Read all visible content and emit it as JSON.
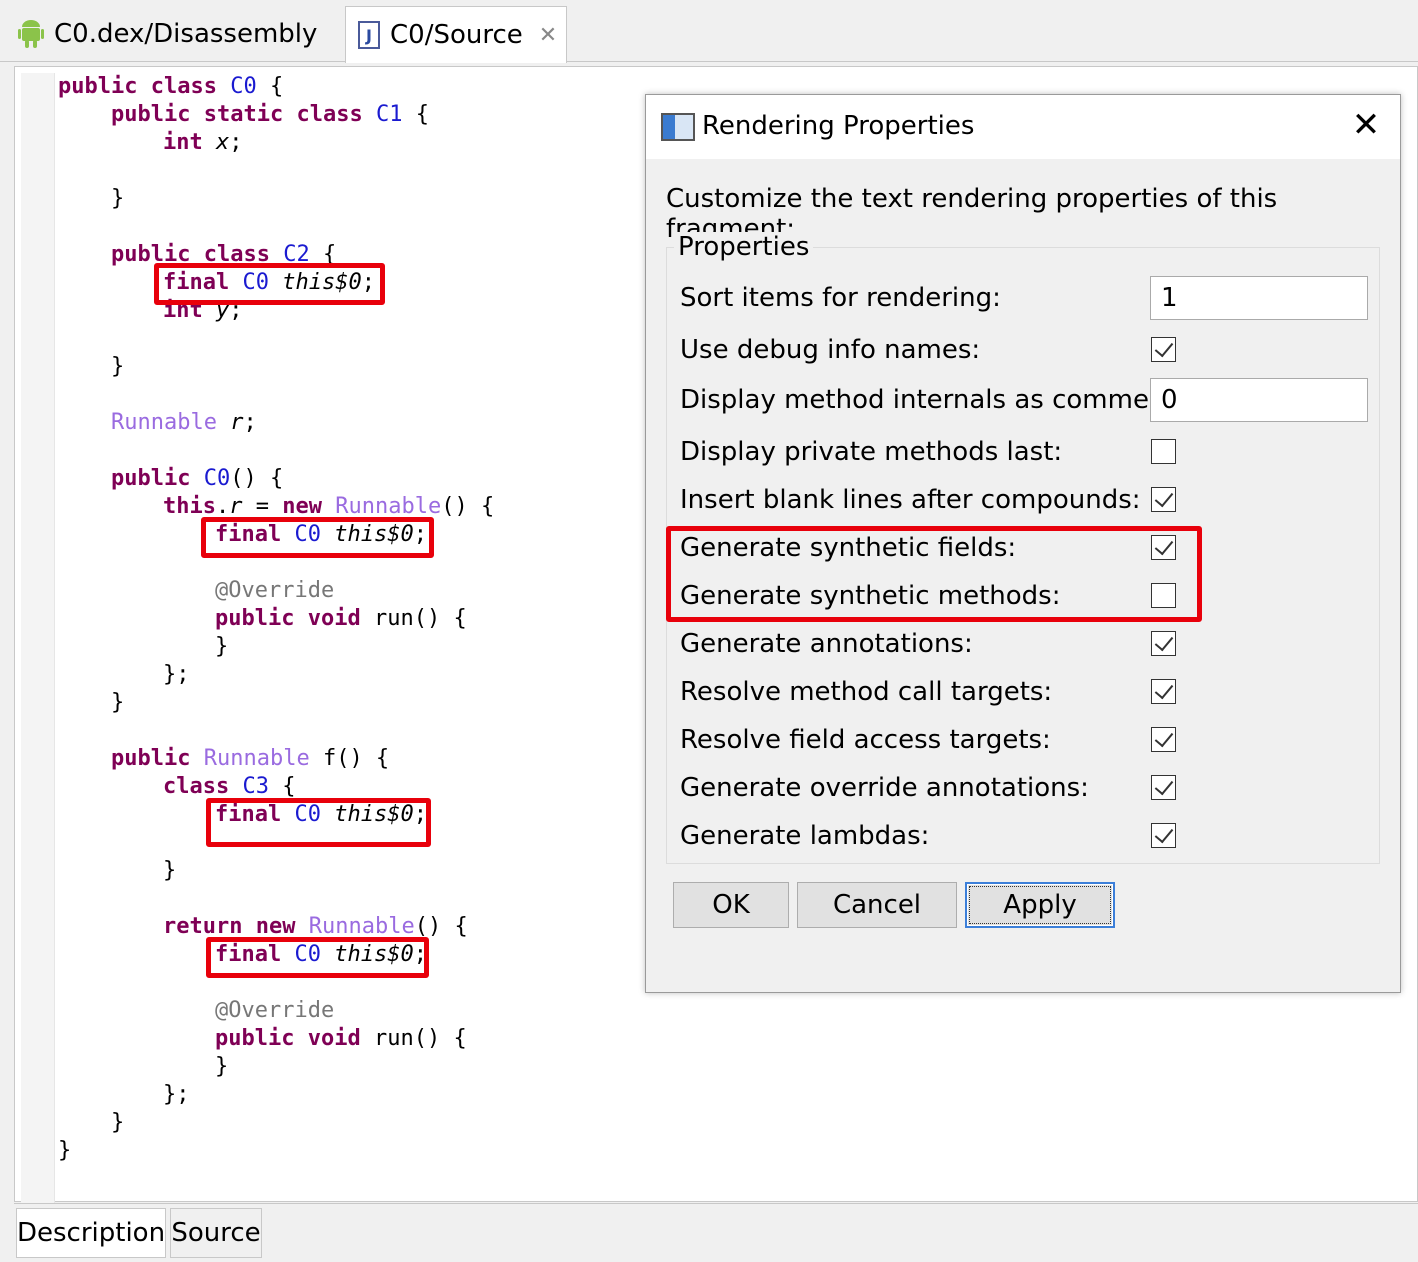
{
  "tabs": [
    {
      "label": "C0.dex/Disassembly",
      "icon": "android-icon"
    },
    {
      "label": "C0/Source",
      "icon": "java-file-icon",
      "close": "✕"
    }
  ],
  "bottom_tabs": [
    "Description",
    "Source"
  ],
  "code": {
    "l1": [
      "public",
      "class",
      "C0",
      "{"
    ],
    "l2": [
      "public",
      "static",
      "class",
      "C1",
      "{"
    ],
    "l3": [
      "int",
      "x",
      ";"
    ],
    "l4": [
      "}"
    ],
    "l5": [
      "public",
      "class",
      "C2",
      "{"
    ],
    "l6": [
      "final",
      "C0",
      "this$0",
      ";"
    ],
    "l7": [
      "int",
      "y",
      ";"
    ],
    "l8": [
      "}"
    ],
    "l9": [
      "Runnable",
      "r",
      ";"
    ],
    "l10": [
      "public",
      "C0",
      "() {"
    ],
    "l11": [
      "this",
      ".",
      "r",
      " = ",
      "new",
      "Runnable",
      "() {"
    ],
    "l12": [
      "final",
      "C0",
      "this$0",
      ";"
    ],
    "l13": [
      "@Override"
    ],
    "l14": [
      "public",
      "void",
      "run() {"
    ],
    "l15": [
      "}"
    ],
    "l16": [
      "};"
    ],
    "l17": [
      "}"
    ],
    "l18": [
      "public",
      "Runnable",
      "f() {"
    ],
    "l19": [
      "class",
      "C3",
      "{"
    ],
    "l20": [
      "final",
      "C0",
      "this$0",
      ";"
    ],
    "l21": [
      "}"
    ],
    "l22": [
      "return",
      "new",
      "Runnable",
      "() {"
    ],
    "l23": [
      "final",
      "C0",
      "this$0",
      ";"
    ],
    "l24": [
      "@Override"
    ],
    "l25": [
      "public",
      "void",
      "run() {"
    ],
    "l26": [
      "}"
    ],
    "l27": [
      "};"
    ],
    "l28": [
      "}"
    ],
    "l29": [
      "}"
    ]
  },
  "dialog": {
    "title": "Rendering Properties",
    "close": "✕",
    "description": "Customize the text rendering properties of this fragment:",
    "group_label": "Properties",
    "properties": [
      {
        "label": "Sort items for rendering:",
        "kind": "text",
        "value": "1"
      },
      {
        "label": "Use debug info names:",
        "kind": "check",
        "checked": true
      },
      {
        "label": "Display method internals as comment:",
        "kind": "text",
        "value": "0"
      },
      {
        "label": "Display private methods last:",
        "kind": "check",
        "checked": false
      },
      {
        "label": "Insert blank lines after compounds:",
        "kind": "check",
        "checked": true
      },
      {
        "label": "Generate synthetic fields:",
        "kind": "check",
        "checked": true
      },
      {
        "label": "Generate synthetic methods:",
        "kind": "check",
        "checked": false
      },
      {
        "label": "Generate annotations:",
        "kind": "check",
        "checked": true
      },
      {
        "label": "Resolve method call targets:",
        "kind": "check",
        "checked": true
      },
      {
        "label": "Resolve field access targets:",
        "kind": "check",
        "checked": true
      },
      {
        "label": "Generate override annotations:",
        "kind": "check",
        "checked": true
      },
      {
        "label": "Generate lambdas:",
        "kind": "check",
        "checked": true
      }
    ],
    "buttons": {
      "ok": "OK",
      "cancel": "Cancel",
      "apply": "Apply"
    }
  },
  "colors": {
    "highlight": "#e8000b",
    "keyword": "#7f0055",
    "type": "#1a1ad0",
    "runnable": "#9a6be0",
    "annotation": "#777777"
  }
}
